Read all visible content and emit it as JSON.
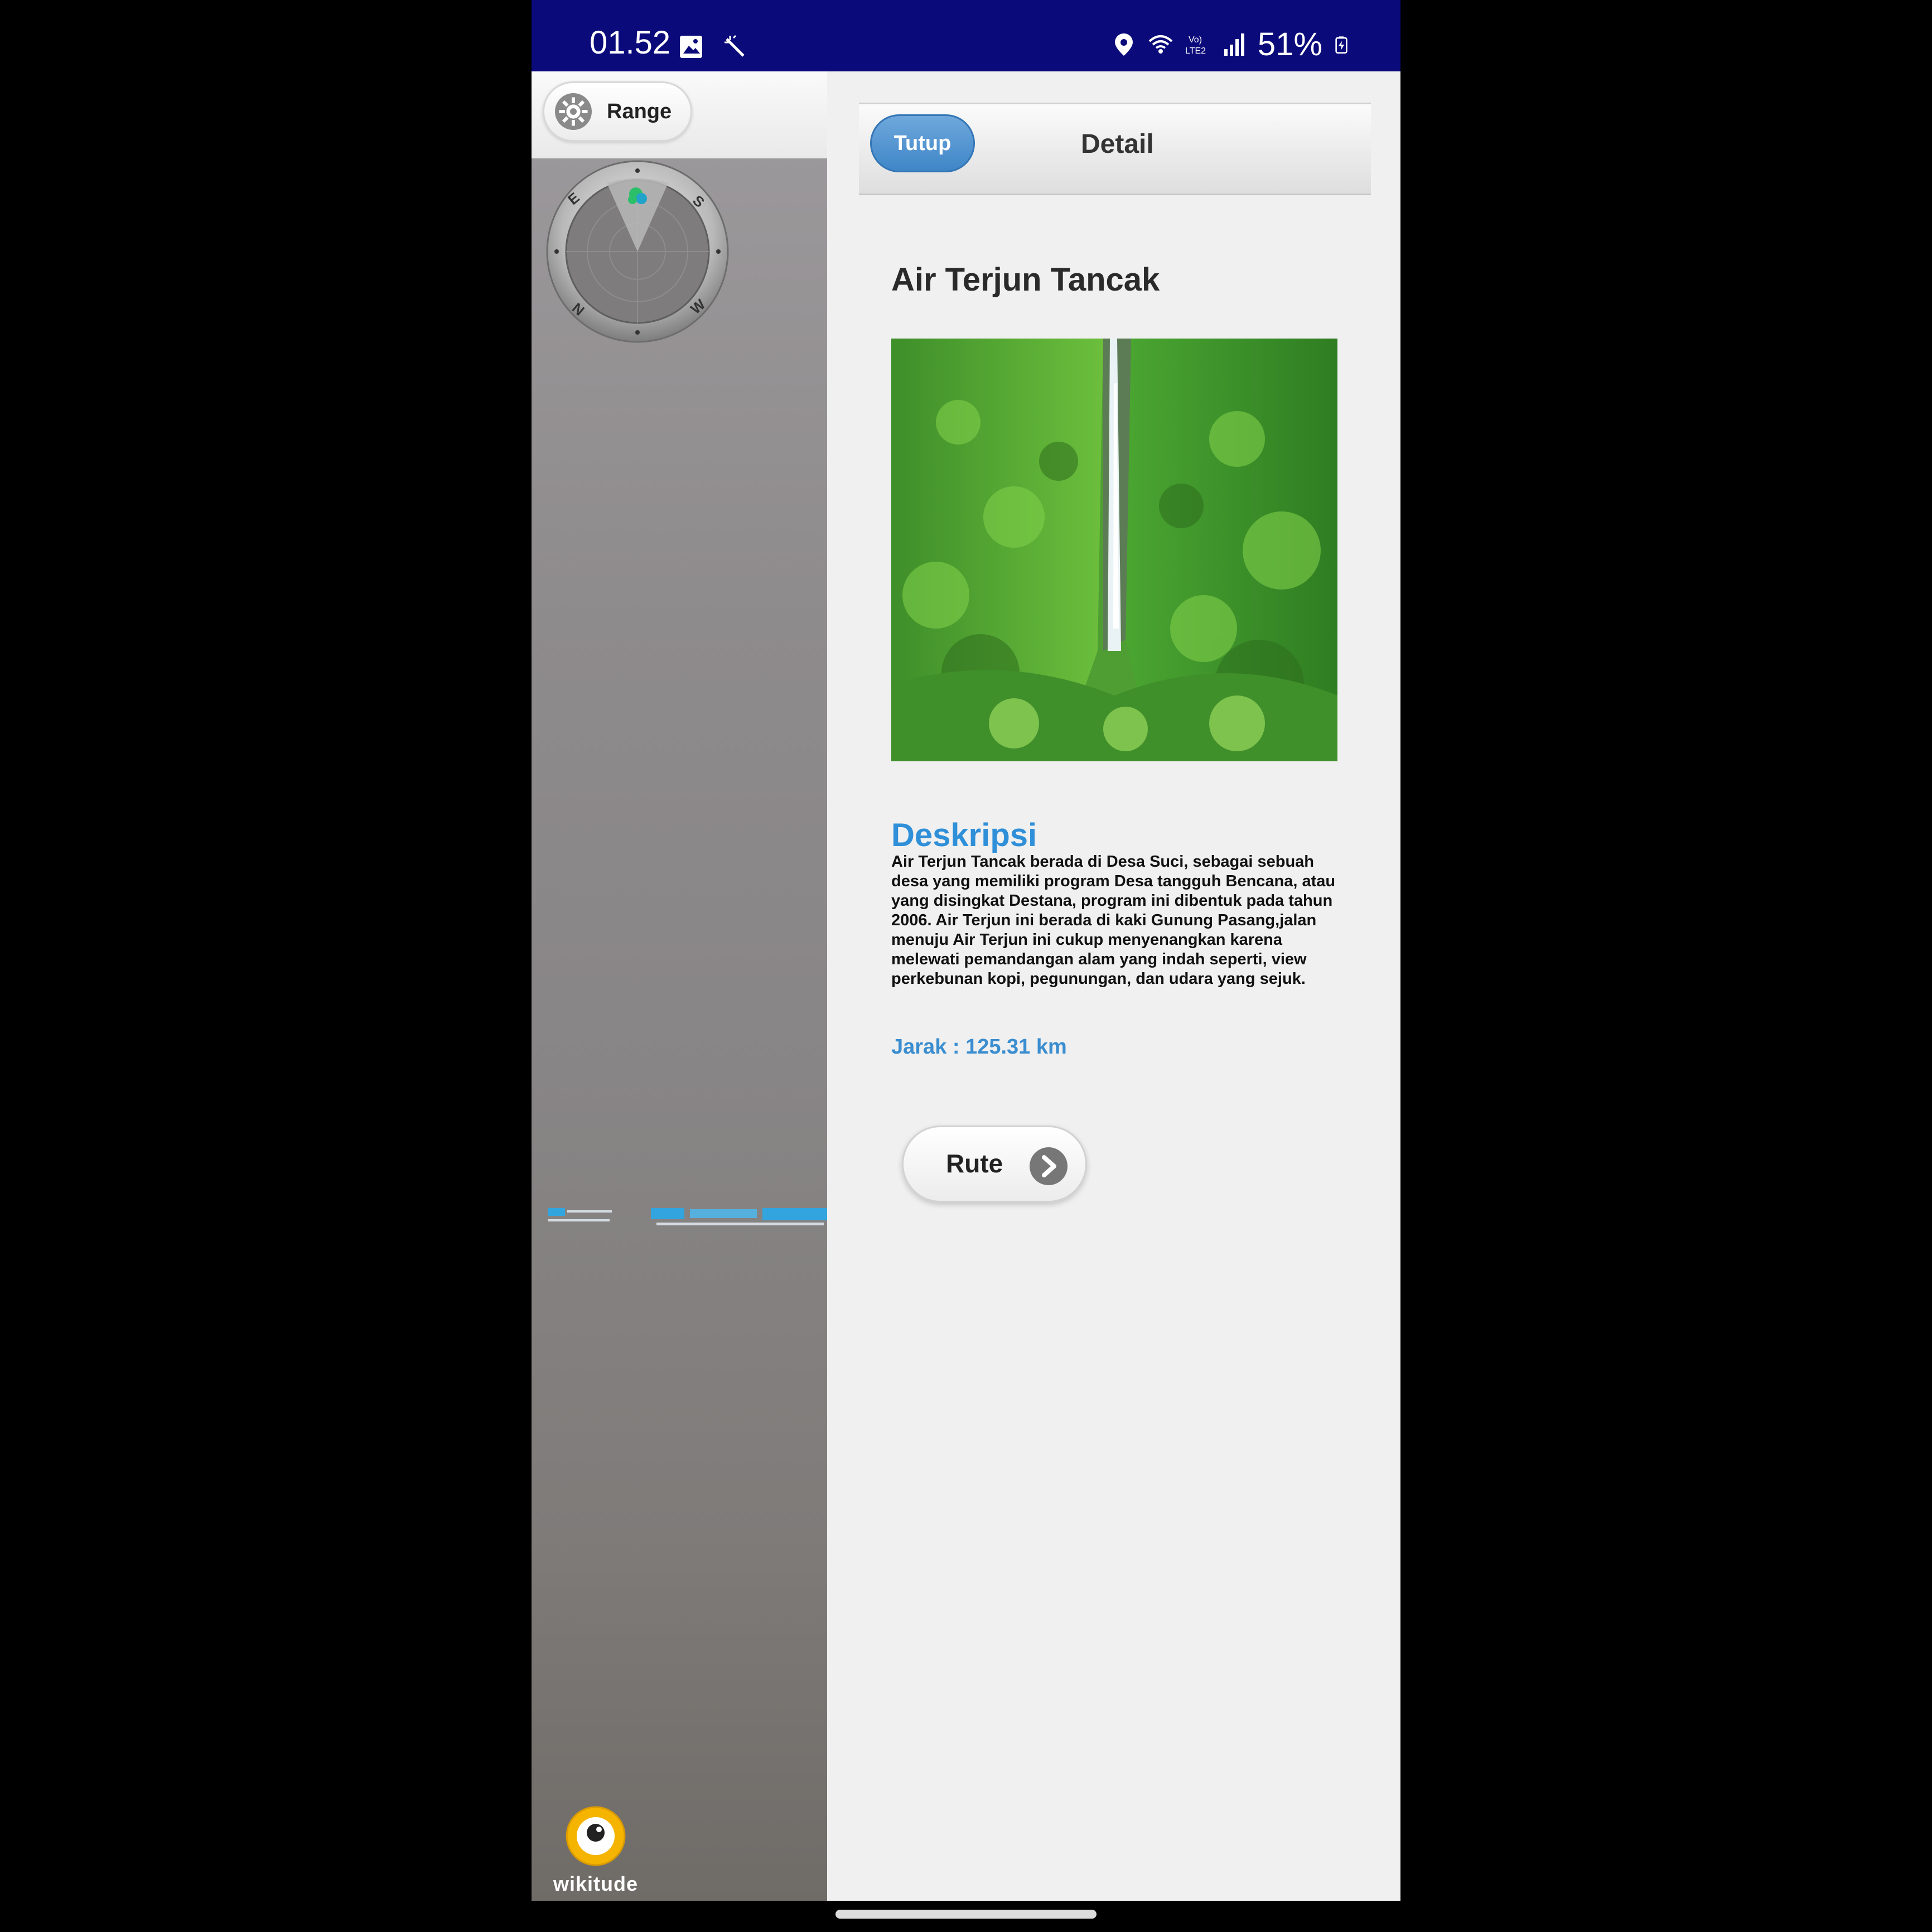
{
  "status_bar": {
    "time": "01.52",
    "battery": "51%",
    "network_label": "Vo)\nLTE2"
  },
  "camera_view": {
    "range_button_label": "Range",
    "compass_labels": [
      "E",
      "S",
      "N",
      "W"
    ],
    "brand_label": "wikitude"
  },
  "detail_panel": {
    "close_button_label": "Tutup",
    "header_title": "Detail",
    "place_title": "Air Terjun Tancak",
    "photo_description": "waterfall",
    "description_heading": "Deskripsi",
    "description_text": "Air Terjun Tancak berada di Desa Suci, sebagai sebuah desa yang memiliki program Desa tangguh Bencana, atau yang disingkat Destana, program ini dibentuk pada tahun 2006. Air Terjun ini berada di kaki Gunung Pasang,jalan menuju Air Terjun ini cukup menyenangkan karena melewati pemandangan alam yang indah seperti, view perkebunan kopi, pegunungan, dan udara yang sejuk.",
    "distance": "Jarak : 125.31 km",
    "route_button_label": "Rute"
  },
  "colors": {
    "status_bar": "#0a0a7a",
    "accent_blue": "#2f8fd8",
    "tutup_blue": "#4a90d2",
    "panel_bg": "#f0f0f0"
  }
}
